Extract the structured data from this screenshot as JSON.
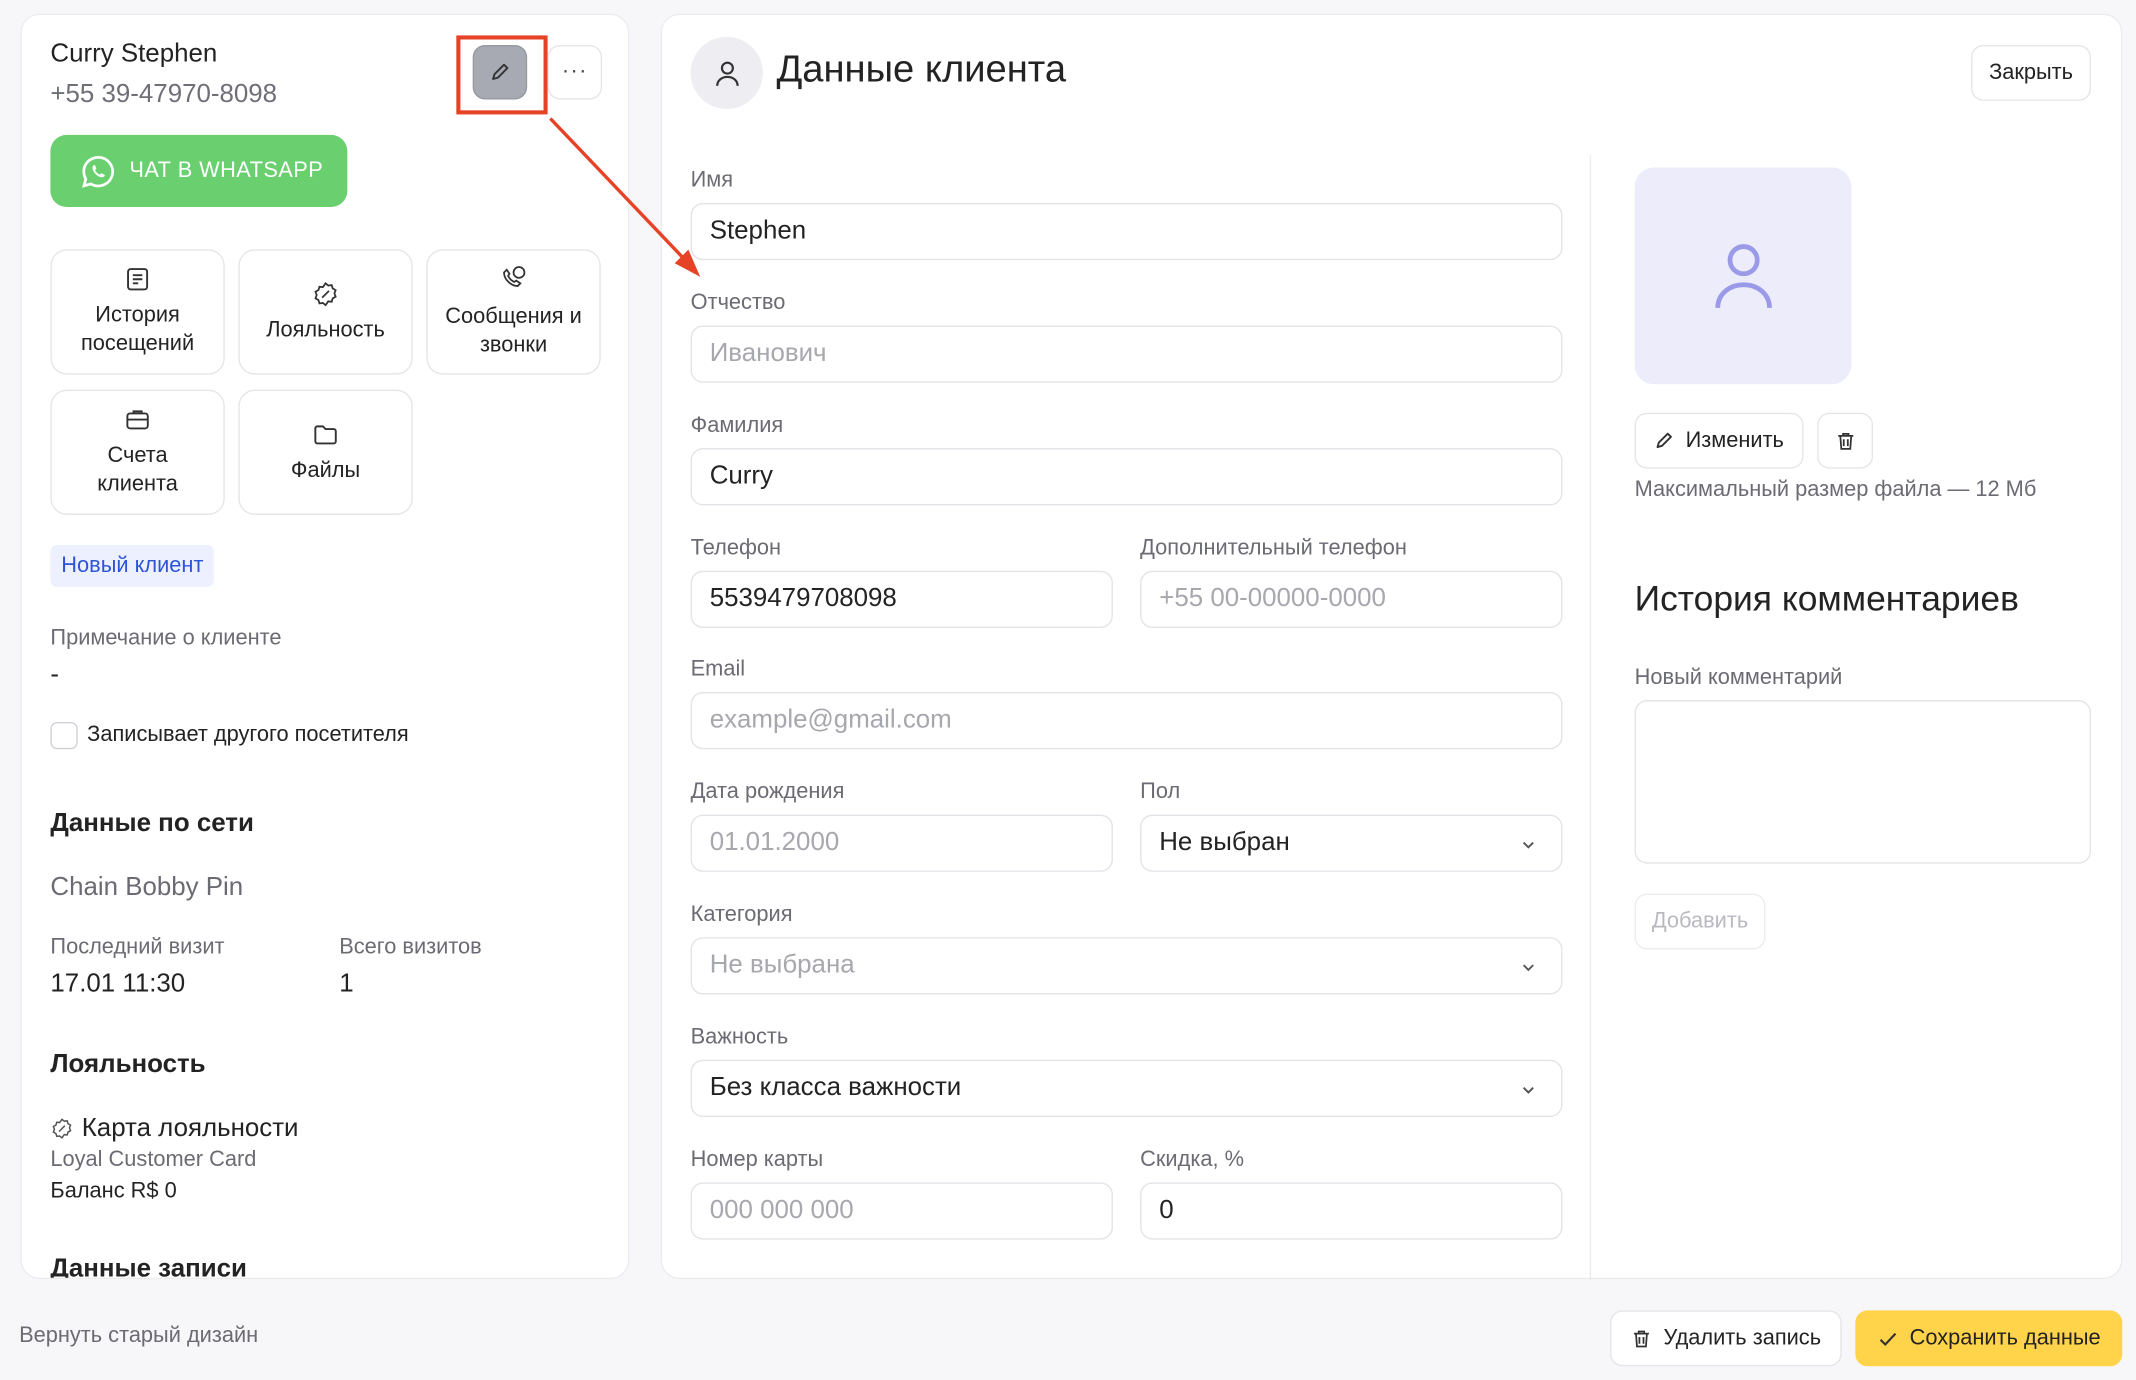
{
  "client": {
    "name": "Curry Stephen",
    "phone": "+55 39-47970-8098",
    "whatsapp_label": "ЧАТ В WHATSAPP",
    "tiles": [
      {
        "label": "История посещений",
        "icon": "history-icon"
      },
      {
        "label": "Лояльность",
        "icon": "loyalty-icon"
      },
      {
        "label": "Сообщения и звонки",
        "icon": "messages-icon"
      },
      {
        "label": "Счета клиента",
        "icon": "briefcase-icon"
      },
      {
        "label": "Файлы",
        "icon": "folder-icon"
      }
    ],
    "badge": "Новый клиент",
    "note_label": "Примечание о клиенте",
    "note_value": "-",
    "checkbox_label": "Записывает другого посетителя",
    "network_title": "Данные по сети",
    "network_name": "Chain Bobby Pin",
    "last_visit_label": "Последний визит",
    "last_visit_value": "17.01 11:30",
    "total_visits_label": "Всего визитов",
    "total_visits_value": "1",
    "loyalty_title": "Лояльность",
    "loyalty_card_title": "Карта лояльности",
    "loyalty_card_name": "Loyal Customer Card",
    "loyalty_balance": "Баланс R$ 0",
    "record_title": "Данные записи"
  },
  "form": {
    "title": "Данные клиента",
    "close_label": "Закрыть",
    "first_name": {
      "label": "Имя",
      "value": "Stephen"
    },
    "middle_name": {
      "label": "Отчество",
      "placeholder": "Иванович"
    },
    "last_name": {
      "label": "Фамилия",
      "value": "Curry"
    },
    "phone": {
      "label": "Телефон",
      "value": "5539479708098"
    },
    "extra_phone": {
      "label": "Дополнительный телефон",
      "placeholder": "+55 00-00000-0000"
    },
    "email": {
      "label": "Email",
      "placeholder": "example@gmail.com"
    },
    "birth_date": {
      "label": "Дата рождения",
      "placeholder": "01.01.2000"
    },
    "gender": {
      "label": "Пол",
      "value": "Не выбран"
    },
    "category": {
      "label": "Категория",
      "placeholder": "Не выбрана"
    },
    "importance": {
      "label": "Важность",
      "value": "Без класса важности"
    },
    "card_number": {
      "label": "Номер карты",
      "placeholder": "000 000 000"
    },
    "discount": {
      "label": "Скидка, %",
      "value": "0"
    }
  },
  "photo": {
    "change_label": "Изменить",
    "hint": "Максимальный размер файла — 12 Мб"
  },
  "comments": {
    "title": "История комментариев",
    "new_label": "Новый комментарий",
    "add_label": "Добавить"
  },
  "footer": {
    "old_design": "Вернуть старый дизайн",
    "delete_label": "Удалить запись",
    "save_label": "Сохранить данные"
  },
  "colors": {
    "whatsapp": "#6ad06f",
    "save": "#ffd44b",
    "highlight": "#e64226",
    "badge_text": "#2e55d6"
  }
}
